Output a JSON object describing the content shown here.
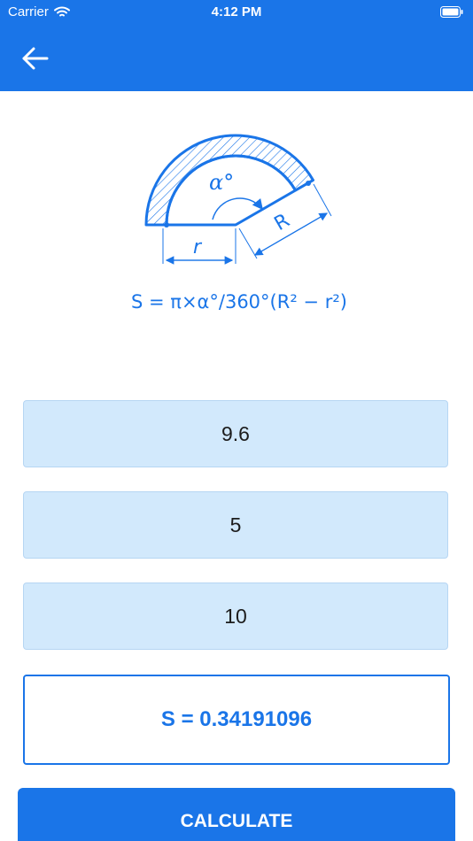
{
  "status_bar": {
    "carrier": "Carrier",
    "time": "4:12 PM"
  },
  "nav": {
    "back_icon": "arrow-left-icon"
  },
  "diagram": {
    "angle_label": "α°",
    "r_label": "r",
    "R_label": "R",
    "formula": "S = π×α°/360°(R² − r²)"
  },
  "inputs": [
    {
      "value": "9.6"
    },
    {
      "value": "5"
    },
    {
      "value": "10"
    }
  ],
  "result": {
    "text": "S = 0.34191096"
  },
  "calculate_button": {
    "label": "CALCULATE"
  },
  "colors": {
    "accent": "#1a75e8",
    "field_bg": "#d2e9fc"
  }
}
